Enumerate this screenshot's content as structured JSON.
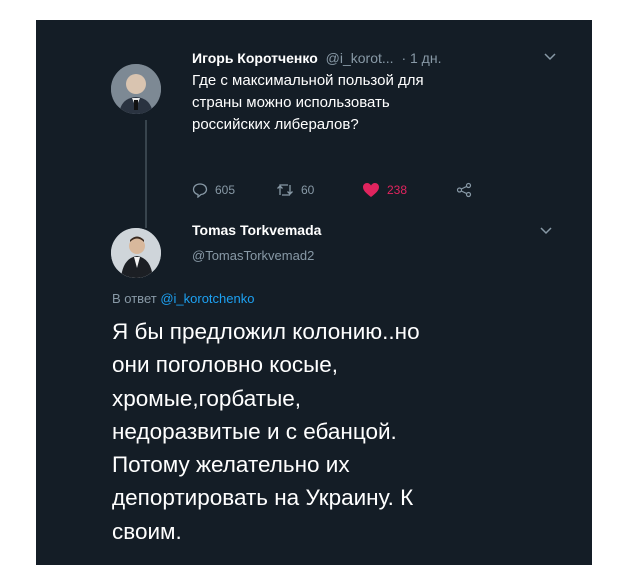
{
  "tweet1": {
    "author_name": "Игорь Коротченко",
    "author_handle": "@i_korot...",
    "time": "· 1 дн.",
    "text_lines": [
      "Где с максимальной пользой для",
      "страны можно использовать",
      "российских либералов?"
    ],
    "reply_count": "605",
    "retweet_count": "60",
    "like_count": "238",
    "icons": {
      "reply": "comment-icon",
      "retweet": "retweet-icon",
      "like": "heart-icon",
      "share": "share-icon",
      "menu": "chevron-down-icon"
    }
  },
  "tweet2": {
    "author_name": "Tomas Torkvemada",
    "author_handle": "@TomasTorkvemad2",
    "reply_to_prefix": "В ответ",
    "reply_to_handle": "@i_korotchenko",
    "text_lines": [
      "Я бы предложил колонию..но",
      "они поголовно косые,",
      "хромые,горбатые,",
      "недоразвитые и с ебанцой.",
      "Потому желательно их",
      "депортировать на Украину. К",
      "своим."
    ]
  },
  "colors": {
    "background": "#141d26",
    "secondary_text": "#8899a6",
    "link": "#1da1f2",
    "like": "#e0245e",
    "thread_line": "#38444d"
  }
}
